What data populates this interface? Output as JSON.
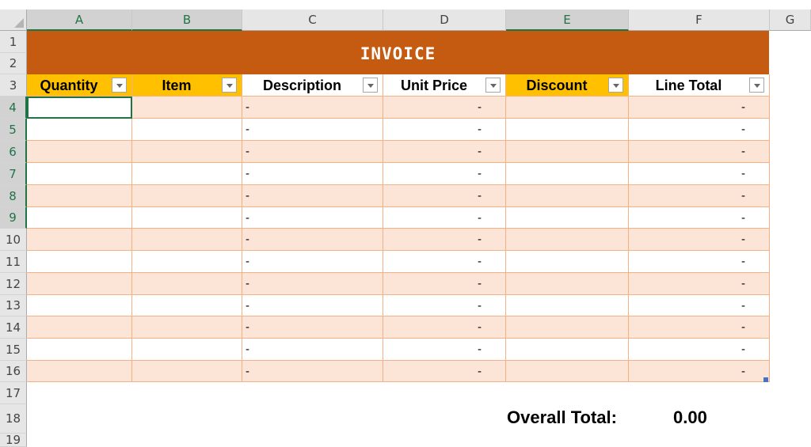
{
  "sheet": {
    "columns": [
      "A",
      "B",
      "C",
      "D",
      "E",
      "F",
      "G"
    ],
    "selected_columns": [
      "A",
      "B",
      "E"
    ],
    "rows": [
      "1",
      "2",
      "3",
      "4",
      "5",
      "6",
      "7",
      "8",
      "9",
      "10",
      "11",
      "12",
      "13",
      "14",
      "15",
      "16",
      "17",
      "18",
      "19"
    ],
    "selected_rows": [
      "4",
      "5",
      "6",
      "7",
      "8",
      "9"
    ]
  },
  "invoice": {
    "title": "INVOICE",
    "headers": [
      "Quantity",
      "Item",
      "Description",
      "Unit Price",
      "Discount",
      "Line Total"
    ],
    "dash": "-",
    "overall_total_label": "Overall Total:",
    "overall_total_value": "0.00"
  },
  "colors": {
    "banner": "#c55a11",
    "header_gold": "#ffc000",
    "band_fill": "#fce4d6",
    "border": "#f4b183",
    "selection": "#217346",
    "selection_shade": "#c0c0c0"
  }
}
